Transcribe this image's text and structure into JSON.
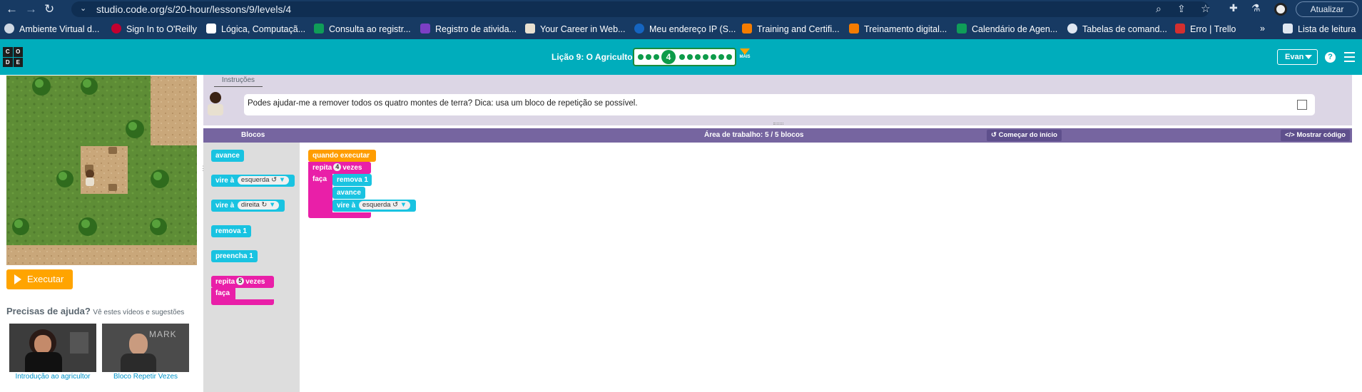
{
  "browser": {
    "url": "studio.code.org/s/20-hour/lessons/9/levels/4",
    "update_label": "Atualizar",
    "bookmarks": [
      "Ambiente Virtual d...",
      "Sign In to O'Reilly",
      "Lógica, Computaçã...",
      "Consulta ao registr...",
      "Registro de ativida...",
      "Your Career in Web...",
      "Meu endereço IP (S...",
      "Training and Certifi...",
      "Treinamento digital...",
      "Calendário de Agen...",
      "Tabelas de comand...",
      "Erro | Trello"
    ],
    "overflow_label": "»",
    "reading_list_label": "Lista de leitura"
  },
  "header": {
    "logo_letters": [
      "C",
      "O",
      "D",
      "E"
    ],
    "lesson_title": "Lição 9: O Agricultor",
    "current_level": "4",
    "more_label": "MAIS",
    "user_name": "Evan",
    "help_label": "?"
  },
  "game": {
    "run_label": "Executar"
  },
  "help": {
    "title": "Precisas de ajuda?",
    "subtitle": "Vê estes vídeos e sugestões",
    "videos": [
      {
        "caption": "Introdução ao agricultor"
      },
      {
        "caption": "Bloco Repetir Vezes",
        "overlay": "MARK"
      }
    ]
  },
  "instructions": {
    "tab_label": "Instruções",
    "text": "Podes ajudar-me a remover todos os quatro montes de terra? Dica: usa um bloco de repetição se possível."
  },
  "workspace": {
    "toolbox_label": "Blocos",
    "title": "Área de trabalho: 5 / 5 blocos",
    "start_over_label": "Começar do início",
    "show_code_label": "Mostrar código"
  },
  "toolbox_blocks": {
    "forward": "avance",
    "turn_prefix": "vire à",
    "left": "esquerda ↺",
    "right": "direita ↻",
    "remove": "remova 1",
    "fill": "preencha 1",
    "repeat_prefix": "repita",
    "repeat_count": "5",
    "repeat_suffix": "vezes",
    "do_label": "faça"
  },
  "program_blocks": {
    "when_run": "quando executar",
    "repeat_prefix": "repita",
    "repeat_count": "4",
    "repeat_suffix": "vezes",
    "do_label": "faça",
    "remove": "remova 1",
    "forward": "avance",
    "turn_prefix": "vire à",
    "left": "esquerda ↺"
  },
  "colors": {
    "browser": "#173a63",
    "header": "#00adbc",
    "workspace_header": "#7665a0",
    "block_action": "#19c3e1",
    "block_loop": "#e91fa8",
    "block_event": "#ff9d00",
    "run_button": "#ffa400"
  }
}
